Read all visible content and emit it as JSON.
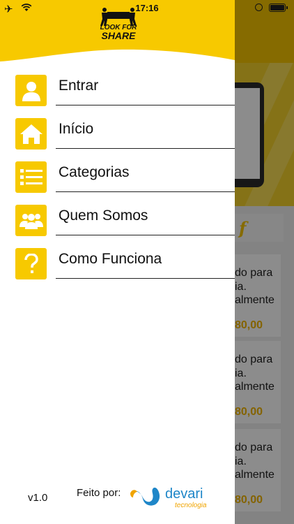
{
  "status_bar": {
    "time": "17:16"
  },
  "brand": {
    "logo_line1": "LOOK FOR",
    "logo_line2": "SHARE"
  },
  "menu": {
    "items": [
      {
        "label": "Entrar",
        "icon": "user-icon"
      },
      {
        "label": "Início",
        "icon": "home-icon"
      },
      {
        "label": "Categorias",
        "icon": "list-icon"
      },
      {
        "label": "Quem Somos",
        "icon": "team-icon"
      },
      {
        "label": "Como Funciona",
        "icon": "question-icon"
      }
    ]
  },
  "footer": {
    "version": "v1.0",
    "made_by_label": "Feito por:",
    "company_name": "devari",
    "company_sub": "tecnologia"
  },
  "background_content": {
    "cards": [
      {
        "line1": "do para",
        "line2": "ia.",
        "line3": "almente",
        "price": "80,00"
      },
      {
        "line1": "do para",
        "line2": "ia.",
        "line3": "almente",
        "price": "80,00"
      },
      {
        "line1": "do para",
        "line2": "ia.",
        "line3": "almente",
        "price": "80,00"
      }
    ]
  },
  "colors": {
    "accent": "#f7c900",
    "brand_blue": "#1e86c8",
    "brand_orange": "#f0a400"
  }
}
